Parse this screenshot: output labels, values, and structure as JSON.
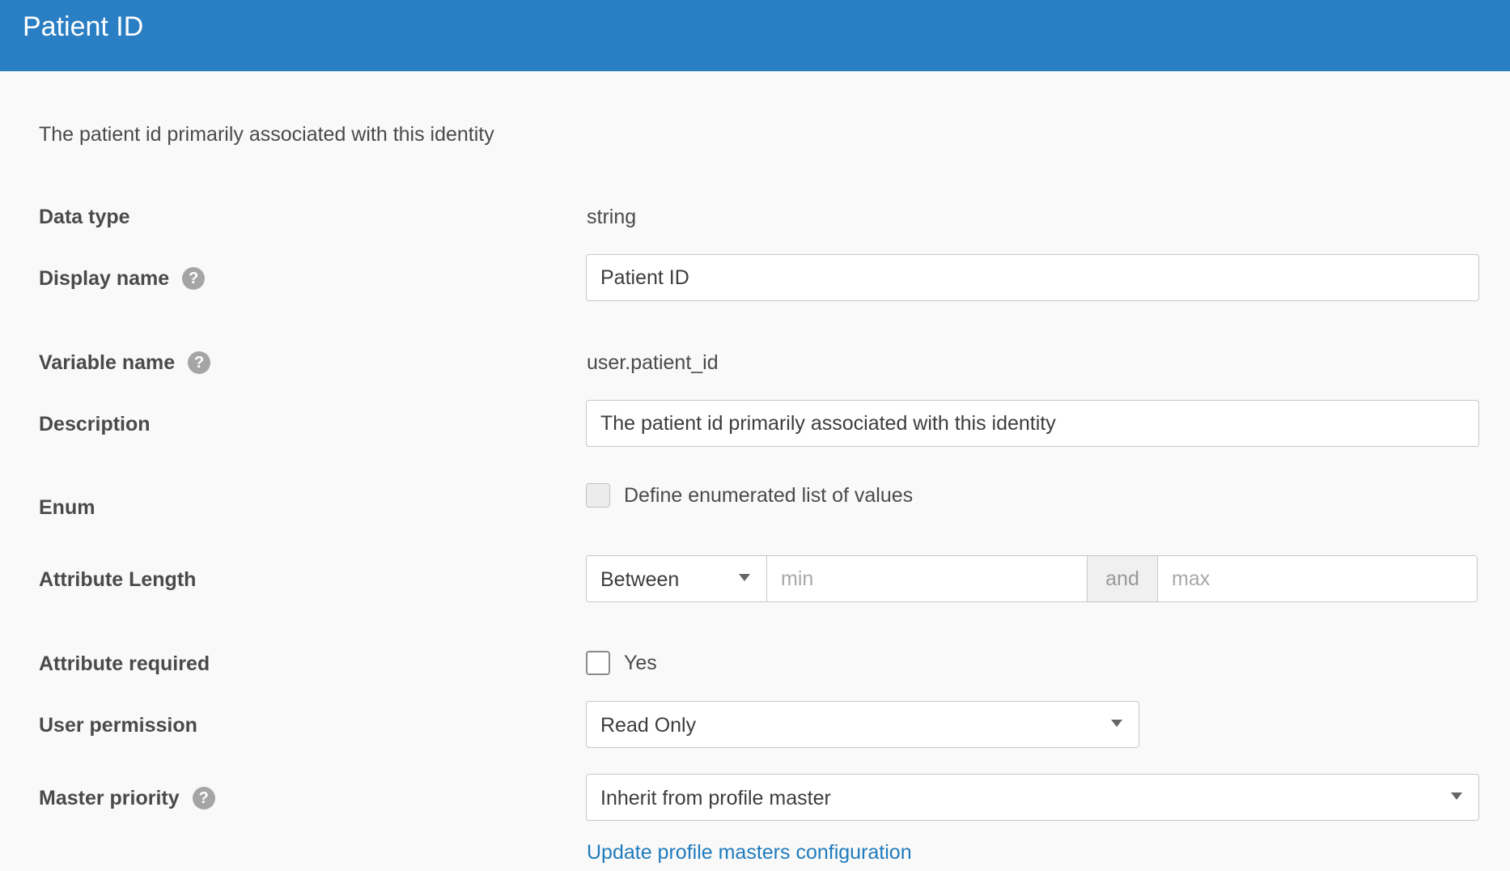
{
  "header": {
    "title": "Patient ID"
  },
  "intro": "The patient id primarily associated with this identity",
  "fields": {
    "data_type": {
      "label": "Data type",
      "value": "string"
    },
    "display_name": {
      "label": "Display name",
      "value": "Patient ID",
      "help": "?"
    },
    "variable_name": {
      "label": "Variable name",
      "value": "user.patient_id",
      "help": "?"
    },
    "description": {
      "label": "Description",
      "value": "The patient id primarily associated with this identity"
    },
    "enum": {
      "label": "Enum",
      "checkbox_label": "Define enumerated list of values",
      "checked": false
    },
    "attribute_length": {
      "label": "Attribute Length",
      "operator": "Between",
      "min_placeholder": "min",
      "and_label": "and",
      "max_placeholder": "max"
    },
    "attribute_required": {
      "label": "Attribute required",
      "checkbox_label": "Yes",
      "checked": false
    },
    "user_permission": {
      "label": "User permission",
      "value": "Read Only"
    },
    "master_priority": {
      "label": "Master priority",
      "value": "Inherit from profile master",
      "help": "?"
    }
  },
  "link": {
    "label": "Update profile masters configuration"
  },
  "colors": {
    "header_bg": "#2a7ec3",
    "link": "#1f7bbd",
    "page_bg": "#f9f9f9"
  },
  "icons": {
    "help": "question-circle-icon",
    "caret": "caret-down-icon"
  }
}
